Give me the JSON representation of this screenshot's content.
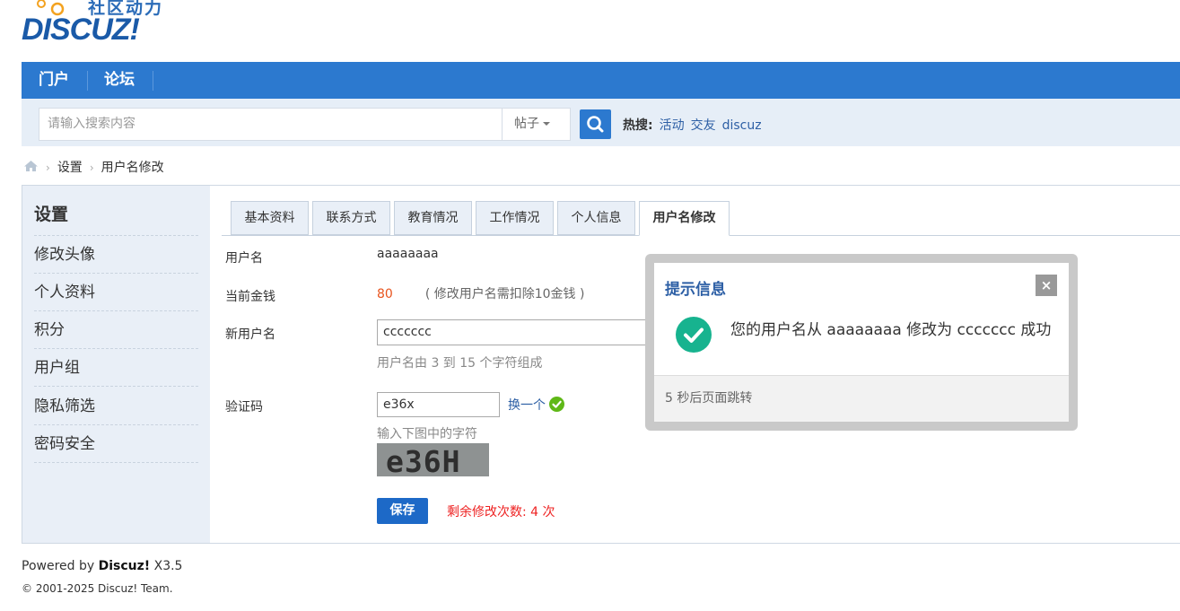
{
  "logo": {
    "cn": "社区动力",
    "en": "DISCUZ!"
  },
  "nav": {
    "items": [
      "门户",
      "论坛"
    ]
  },
  "search": {
    "placeholder": "请输入搜索内容",
    "type": "帖子",
    "hot_label": "热搜:",
    "hot_keywords": [
      "活动",
      "交友",
      "discuz"
    ]
  },
  "breadcrumb": [
    "设置",
    "用户名修改"
  ],
  "sidebar": {
    "title": "设置",
    "items": [
      "修改头像",
      "个人资料",
      "积分",
      "用户组",
      "隐私筛选",
      "密码安全"
    ]
  },
  "tabs": [
    "基本资料",
    "联系方式",
    "教育情况",
    "工作情况",
    "个人信息",
    "用户名修改"
  ],
  "active_tab": "用户名修改",
  "form": {
    "username_label": "用户名",
    "username_value": "aaaaaaaa",
    "money_label": "当前金钱",
    "money_value": "80",
    "money_note": "( 修改用户名需扣除10金钱 )",
    "newname_label": "新用户名",
    "newname_value": "ccccccc",
    "newname_hint": "用户名由 3 到 15 个字符组成",
    "captcha_label": "验证码",
    "captcha_value": "e36x",
    "captcha_change": "换一个",
    "captcha_hint": "输入下图中的字符",
    "captcha_image_text": "e36H",
    "save_label": "保存",
    "remain_text": "剩余修改次数: 4 次"
  },
  "dialog": {
    "title": "提示信息",
    "close": "×",
    "message": "您的用户名从 aaaaaaaa 修改为 ccccccc 成功",
    "footer": "5 秒后页面跳转"
  },
  "footer": {
    "powered_prefix": "Powered by ",
    "powered_brand": "Discuz!",
    "powered_version": " X3.5",
    "copyright": "© 2001-2025 Discuz! Team."
  },
  "colors": {
    "nav": "#2c79cf",
    "searchbar": "#e6eef7",
    "sidebar": "#e9eff7",
    "success": "#17b38f",
    "link": "#2d5fa5",
    "warn": "#e22222"
  }
}
